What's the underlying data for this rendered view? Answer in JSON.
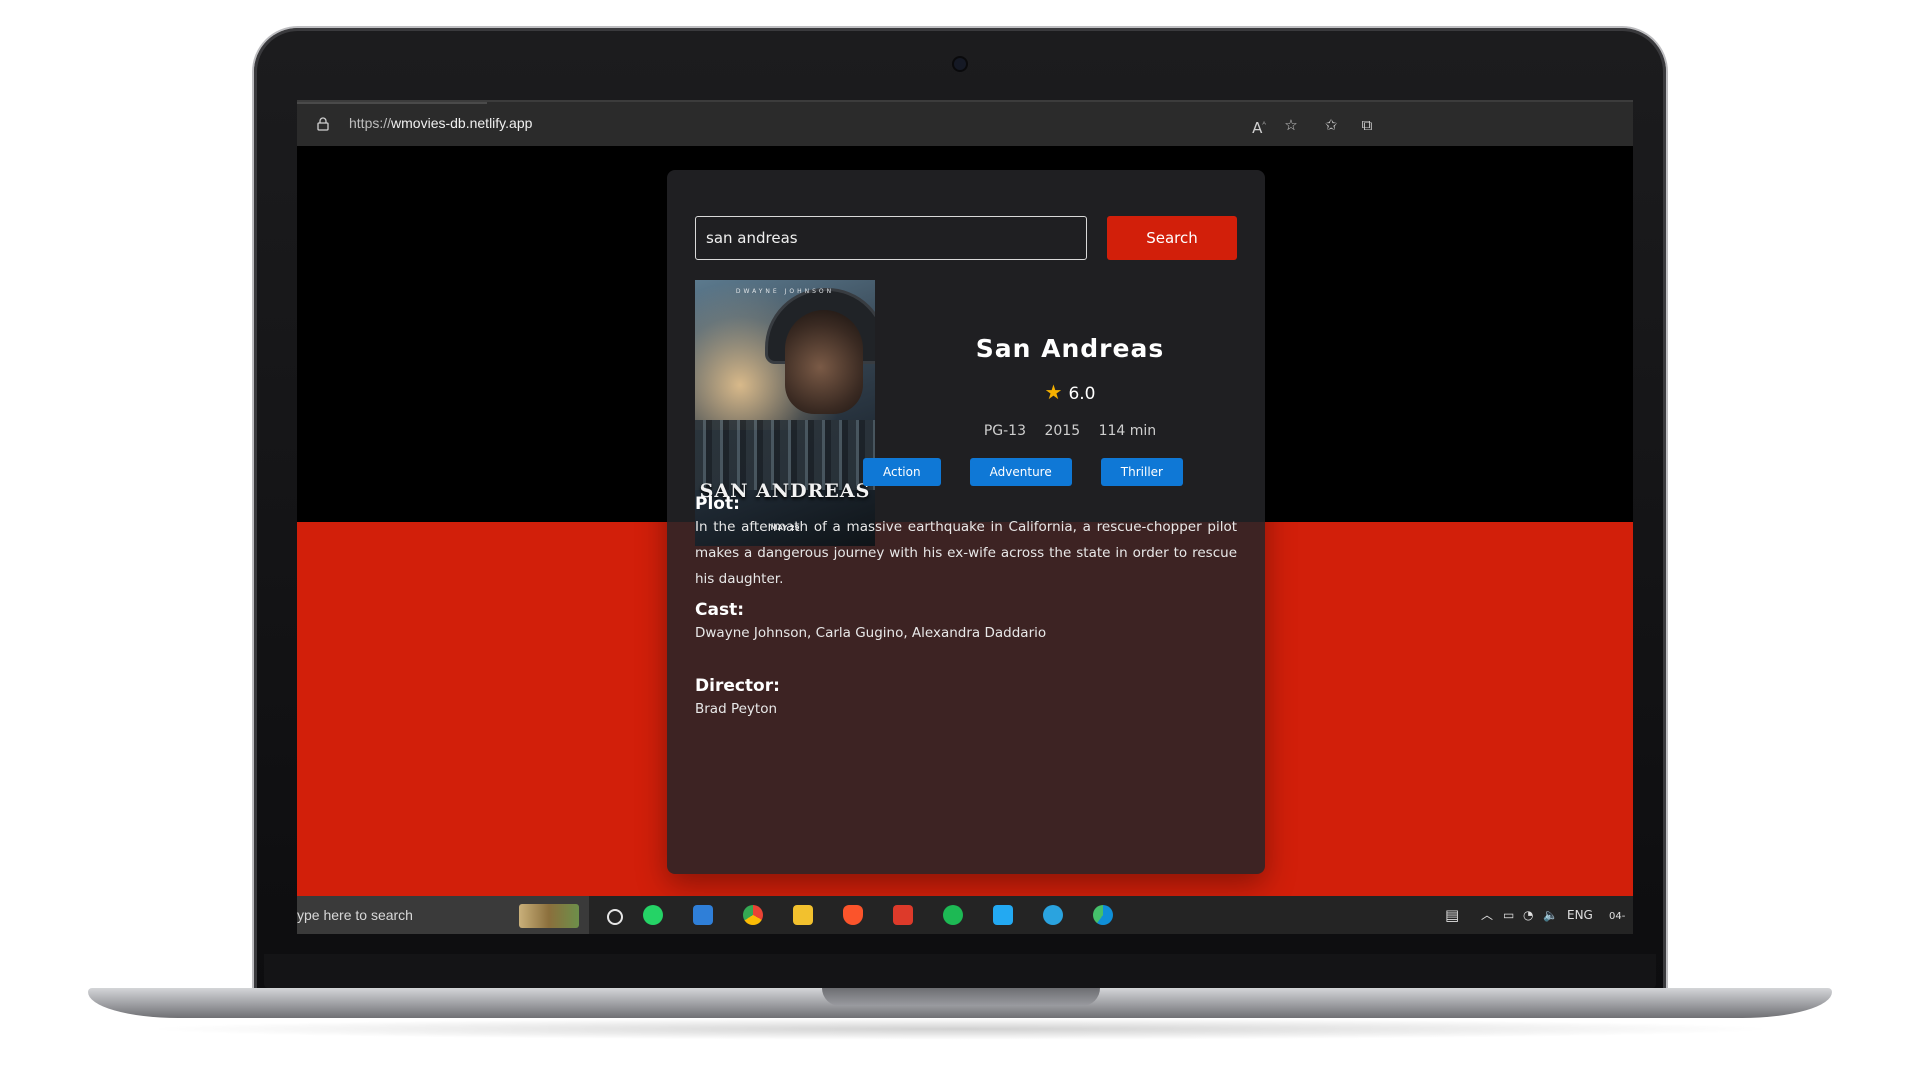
{
  "browser": {
    "url_scheme": "https://",
    "url_host": "wmovies-db.netlify.app"
  },
  "search": {
    "value": "san andreas",
    "button_label": "Search"
  },
  "movie": {
    "poster": {
      "actor": "DWAYNE JOHNSON",
      "title": "SAN ANDREAS",
      "date": "MAY 29"
    },
    "title": "San Andreas",
    "rating": "6.0",
    "rated": "PG-13",
    "year": "2015",
    "runtime": "114 min",
    "genres": [
      "Action",
      "Adventure",
      "Thriller"
    ],
    "plot_heading": "Plot:",
    "plot": "In the aftermath of a massive earthquake in California, a rescue-chopper pilot makes a dangerous journey with his ex-wife across the state in order to rescue his daughter.",
    "cast_heading": "Cast:",
    "cast": "Dwayne Johnson, Carla Gugino, Alexandra Daddario",
    "director_heading": "Director:",
    "director": "Brad Peyton"
  },
  "taskbar": {
    "search_placeholder": "ype here to search",
    "language": "ENG",
    "date_fragment": "04-"
  },
  "colors": {
    "accent_red": "#d21f0a",
    "genre_blue": "#0f78d6",
    "star": "#f5b000"
  }
}
